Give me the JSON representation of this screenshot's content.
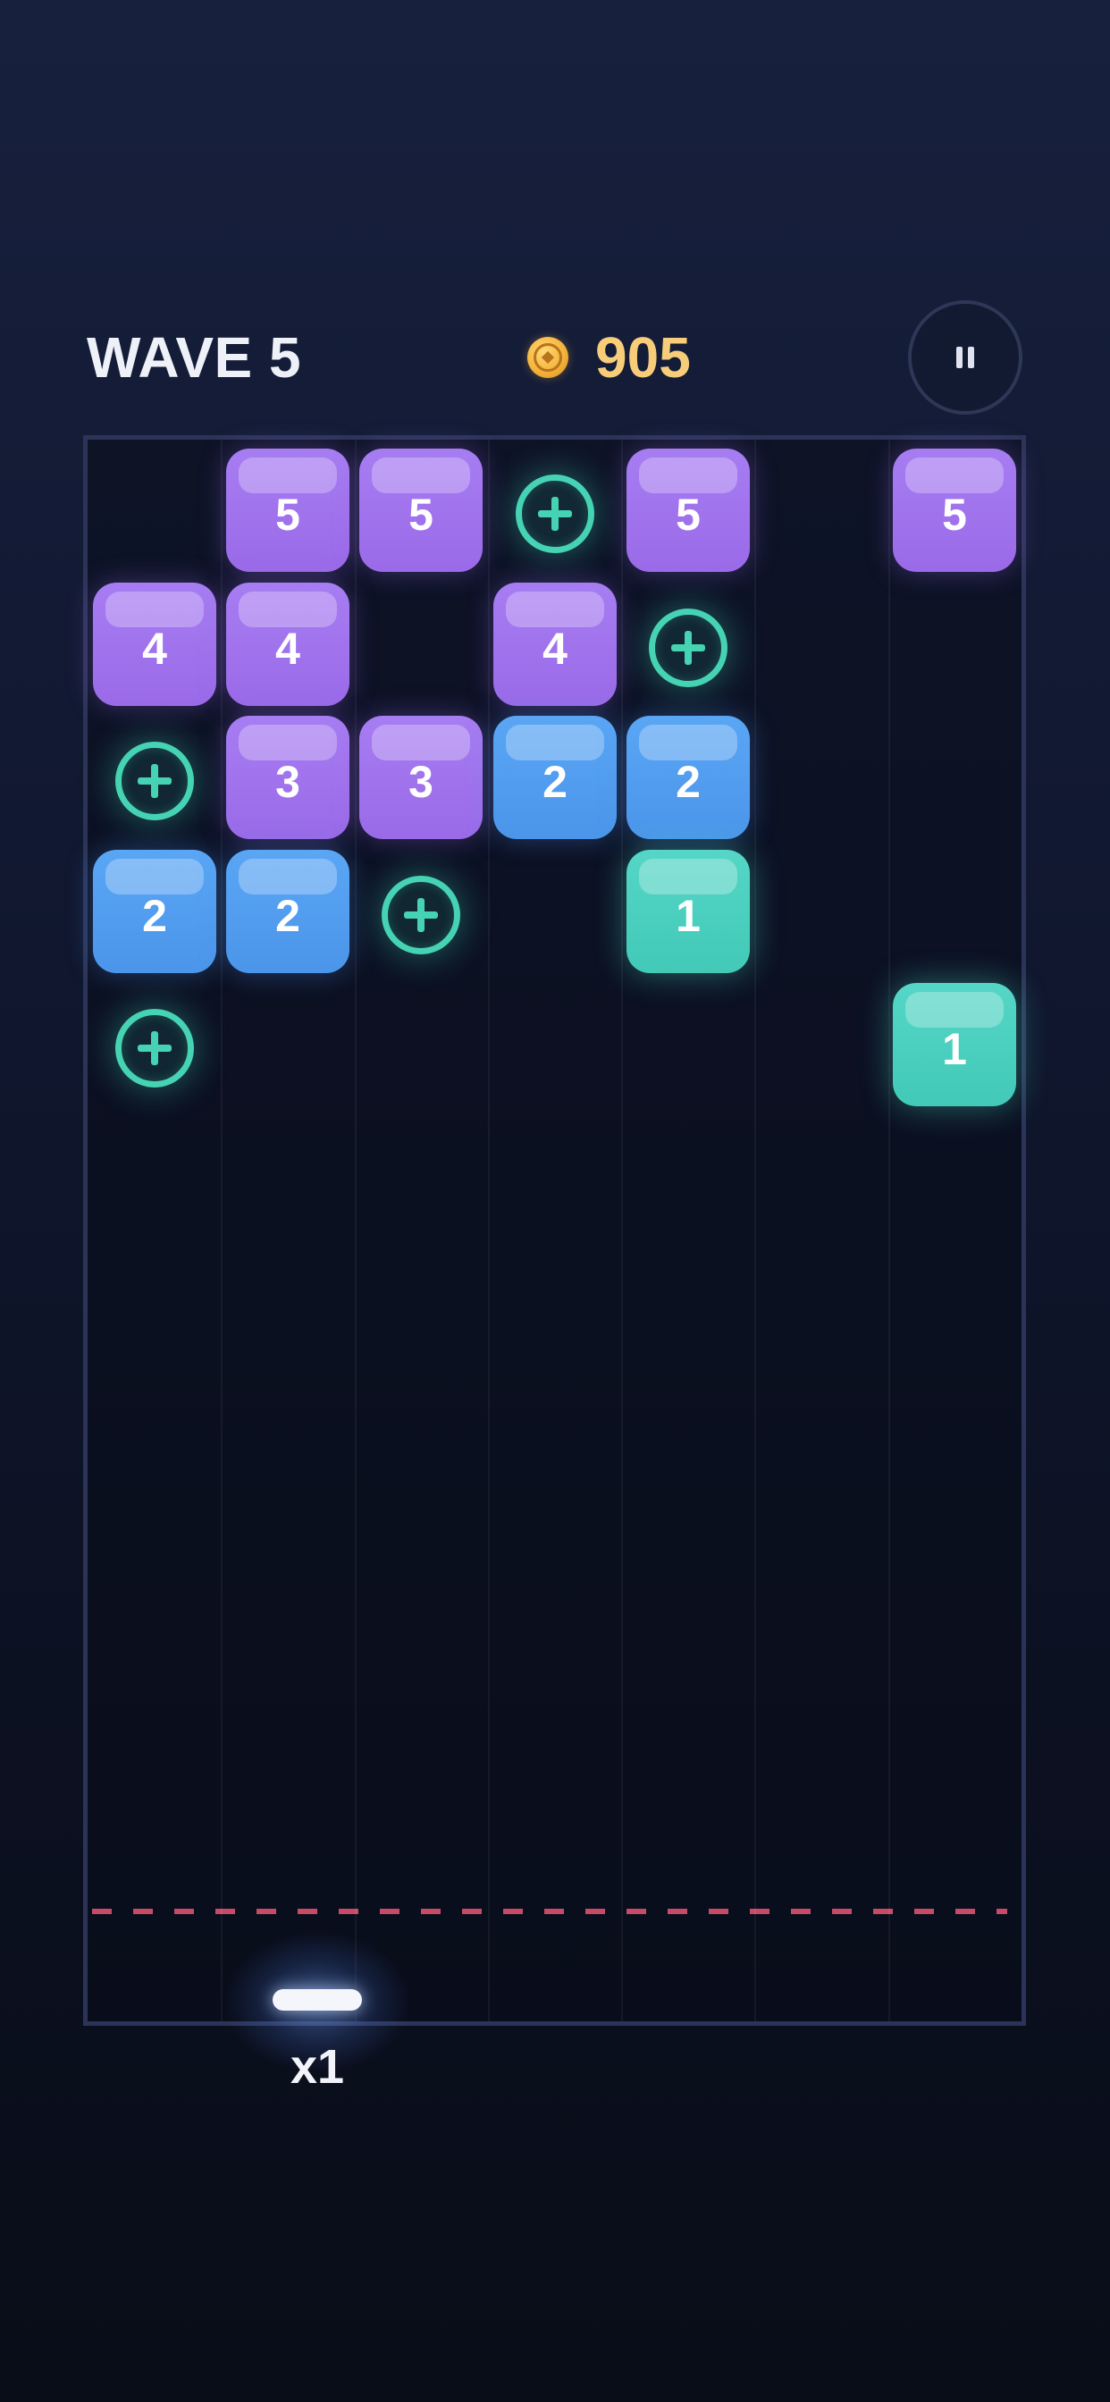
{
  "header": {
    "wave_label": "WAVE 5",
    "coin_icon": "coin-icon",
    "coins": "905",
    "pause_icon": "pause-icon"
  },
  "colors": {
    "purple": "#9d70ee",
    "blue": "#4f9bef",
    "teal": "#48cdbb",
    "bonus": "#46d3b4",
    "danger_line": "#c94a67",
    "coin": "#f5b43c"
  },
  "board": {
    "columns": 7,
    "blocks": [
      {
        "row": 0,
        "col": 1,
        "value": "5",
        "color": "purple"
      },
      {
        "row": 0,
        "col": 2,
        "value": "5",
        "color": "purple"
      },
      {
        "row": 0,
        "col": 4,
        "value": "5",
        "color": "purple"
      },
      {
        "row": 0,
        "col": 6,
        "value": "5",
        "color": "purple"
      },
      {
        "row": 1,
        "col": 0,
        "value": "4",
        "color": "purple"
      },
      {
        "row": 1,
        "col": 1,
        "value": "4",
        "color": "purple"
      },
      {
        "row": 1,
        "col": 3,
        "value": "4",
        "color": "purple"
      },
      {
        "row": 2,
        "col": 1,
        "value": "3",
        "color": "purple"
      },
      {
        "row": 2,
        "col": 2,
        "value": "3",
        "color": "purple"
      },
      {
        "row": 2,
        "col": 3,
        "value": "2",
        "color": "blue"
      },
      {
        "row": 2,
        "col": 4,
        "value": "2",
        "color": "blue"
      },
      {
        "row": 3,
        "col": 0,
        "value": "2",
        "color": "blue"
      },
      {
        "row": 3,
        "col": 1,
        "value": "2",
        "color": "blue"
      },
      {
        "row": 3,
        "col": 4,
        "value": "1",
        "color": "teal"
      },
      {
        "row": 4,
        "col": 6,
        "value": "1",
        "color": "teal"
      }
    ],
    "bonus_pickups": [
      {
        "row": 0,
        "col": 3,
        "icon": "plus-ball-icon"
      },
      {
        "row": 1,
        "col": 4,
        "icon": "plus-ball-icon"
      },
      {
        "row": 2,
        "col": 0,
        "icon": "plus-ball-icon"
      },
      {
        "row": 3,
        "col": 2,
        "icon": "plus-ball-icon"
      },
      {
        "row": 4,
        "col": 0,
        "icon": "plus-ball-icon"
      }
    ]
  },
  "launcher": {
    "ball_count": "x1"
  }
}
